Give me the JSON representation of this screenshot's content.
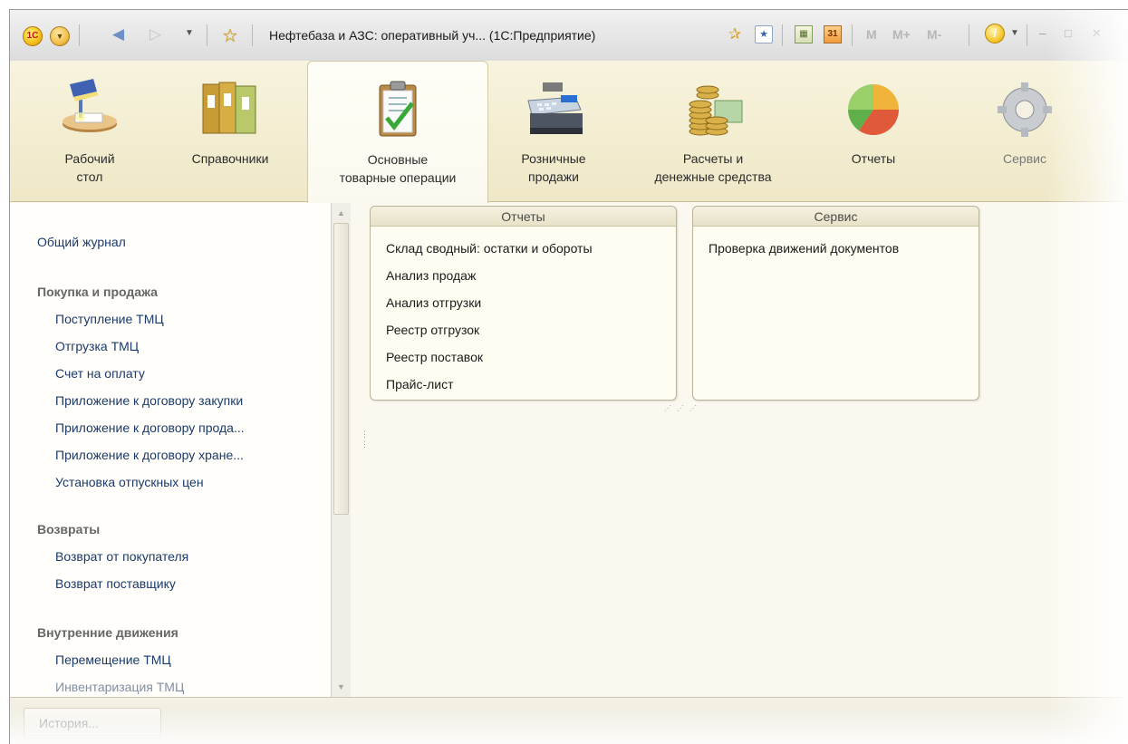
{
  "window": {
    "title": "Нефтебаза и АЗС: оперативный уч... (1С:Предприятие)",
    "app_logo_text": "1С",
    "memory_buttons": [
      "M",
      "M+",
      "M-"
    ],
    "calendar_day": "31"
  },
  "sections": [
    {
      "id": "desktop",
      "label_line1": "Рабочий",
      "label_line2": "стол",
      "icon": "desk-lamp-icon"
    },
    {
      "id": "catalogs",
      "label_line1": "Справочники",
      "label_line2": "",
      "icon": "binders-icon"
    },
    {
      "id": "operations",
      "label_line1": "Основные",
      "label_line2": "товарные операции",
      "icon": "clipboard-checklist-icon",
      "active": true
    },
    {
      "id": "retail",
      "label_line1": "Розничные",
      "label_line2": "продажи",
      "icon": "cash-register-icon"
    },
    {
      "id": "money",
      "label_line1": "Расчеты и",
      "label_line2": "денежные средства",
      "icon": "coins-banknotes-icon"
    },
    {
      "id": "reports",
      "label_line1": "Отчеты",
      "label_line2": "",
      "icon": "pie-chart-icon"
    },
    {
      "id": "service",
      "label_line1": "Сервис",
      "label_line2": "",
      "icon": "gear-icon"
    }
  ],
  "nav": {
    "journal": "Общий журнал",
    "group_purchase": "Покупка и продажа",
    "purchase_items": [
      "Поступление ТМЦ",
      "Отгрузка ТМЦ",
      "Счет на оплату",
      "Приложение к договору закупки",
      "Приложение к договору прода...",
      "Приложение к договору хране...",
      "Установка отпускных цен"
    ],
    "group_returns": "Возвраты",
    "returns_items": [
      "Возврат от покупателя",
      "Возврат поставщику"
    ],
    "group_internal": "Внутренние движения",
    "internal_items": [
      "Перемещение ТМЦ",
      "Инвентаризация ТМЦ"
    ]
  },
  "panels": {
    "reports": {
      "title": "Отчеты",
      "items": [
        "Склад сводный: остатки и обороты",
        "Анализ продаж",
        "Анализ отгрузки",
        "Реестр отгрузок",
        "Реестр поставок",
        "Прайс-лист"
      ]
    },
    "service": {
      "title": "Сервис",
      "items": [
        "Проверка движений документов"
      ]
    }
  },
  "bottom": {
    "history_label": "История..."
  }
}
